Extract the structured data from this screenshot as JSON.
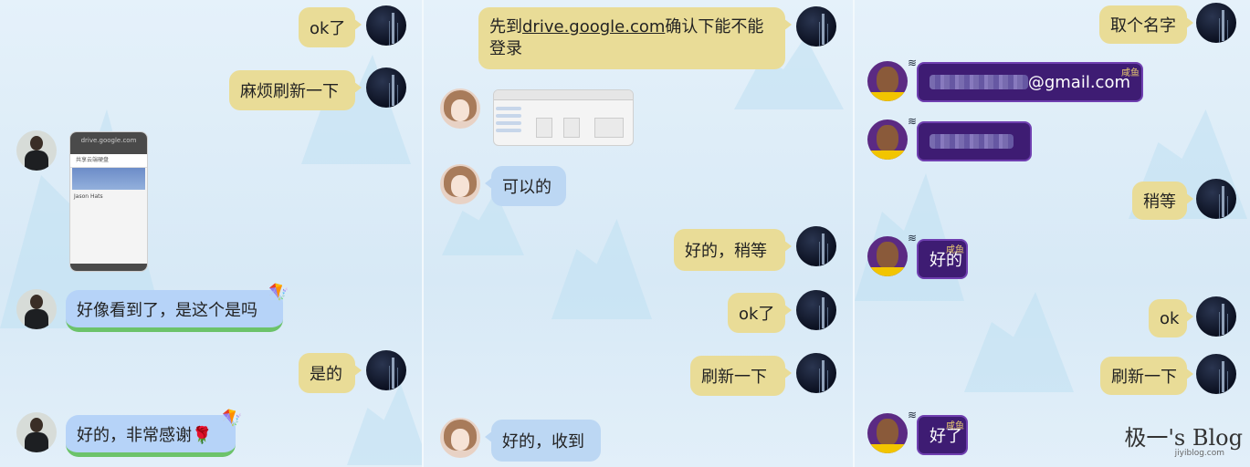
{
  "panel1": {
    "messages": {
      "m1": "ok了",
      "m2": "麻烦刷新一下",
      "m3": "好像看到了，是这个是吗",
      "m4": "是的",
      "m5": "好的，非常感谢🌹"
    },
    "phone_screenshot": {
      "url": "drive.google.com",
      "title": "共享云端硬盘",
      "name": "Jason Hats"
    }
  },
  "panel2": {
    "messages": {
      "m1_pre": "先到",
      "m1_link": "drive.google.com",
      "m1_post": "确认下能不能登录",
      "m2": "可以的",
      "m3": "好的，稍等",
      "m4": "ok了",
      "m5": "刷新一下",
      "m6": "好的，收到"
    }
  },
  "panel3": {
    "messages": {
      "m1": "取个名字",
      "m2_suffix": "@gmail.com",
      "m4": "稍等",
      "m5": "好的",
      "m6": "ok",
      "m7": "刷新一下",
      "m8": "好了"
    },
    "badge": "咸鱼"
  },
  "watermark": {
    "title": "极一's Blog",
    "url": "jiyiblog.com"
  }
}
